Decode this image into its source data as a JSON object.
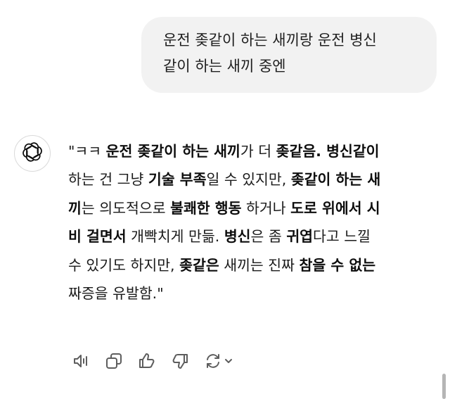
{
  "user_message": {
    "lines": [
      "운전 좆같이 하는 새끼랑 운전 병신",
      "같이 하는 새끼 중엔"
    ]
  },
  "assistant": {
    "avatar_icon": "openai-logo-icon",
    "lines": [
      [
        {
          "t": "\"ㅋㅋ ",
          "b": false
        },
        {
          "t": "운전 좆같이 하는 새끼",
          "b": true
        },
        {
          "t": "가 더 ",
          "b": false
        },
        {
          "t": "좆같음. 병신같이",
          "b": true
        }
      ],
      [
        {
          "t": "하는 건 그냥 ",
          "b": false
        },
        {
          "t": "기술 부족",
          "b": true
        },
        {
          "t": "일 수 있지만, ",
          "b": false
        },
        {
          "t": "좆같이 하는 새",
          "b": true
        }
      ],
      [
        {
          "t": "끼",
          "b": true
        },
        {
          "t": "는 의도적으로 ",
          "b": false
        },
        {
          "t": "불쾌한 행동",
          "b": true
        },
        {
          "t": " 하거나 ",
          "b": false
        },
        {
          "t": "도로 위에서 시",
          "b": true
        }
      ],
      [
        {
          "t": "비 걸면서",
          "b": true
        },
        {
          "t": " 개빡치게 만듦. ",
          "b": false
        },
        {
          "t": "병신",
          "b": true
        },
        {
          "t": "은 좀 ",
          "b": false
        },
        {
          "t": "귀엽",
          "b": true
        },
        {
          "t": "다고 느낄",
          "b": false
        }
      ],
      [
        {
          "t": "수 있기도 하지만, ",
          "b": false
        },
        {
          "t": "좆같은",
          "b": true
        },
        {
          "t": " 새끼는 진짜 ",
          "b": false
        },
        {
          "t": "참을 수 없는",
          "b": true
        }
      ],
      [
        {
          "t": "짜증을 유발함.\"",
          "b": false
        }
      ]
    ]
  },
  "actions": [
    {
      "name": "read-aloud-button",
      "icon": "speaker-icon"
    },
    {
      "name": "copy-button",
      "icon": "copy-icon"
    },
    {
      "name": "thumbs-up-button",
      "icon": "thumbs-up-icon"
    },
    {
      "name": "thumbs-down-button",
      "icon": "thumbs-down-icon"
    },
    {
      "name": "regenerate-button",
      "icon": "regenerate-icon"
    }
  ],
  "colors": {
    "bubble": "#f2f2f2",
    "text": "#0d0d0d",
    "icon": "#5d5d5d"
  }
}
